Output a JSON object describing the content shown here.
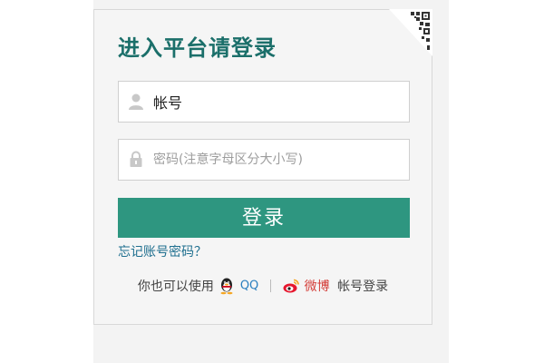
{
  "login": {
    "title": "进入平台请登录",
    "username": {
      "value": "帐号",
      "icon": "user-icon"
    },
    "password": {
      "placeholder": "密码(注意字母区分大小写)",
      "icon": "lock-icon"
    },
    "submit_label": "登录",
    "forgot_label": "忘记账号密码？",
    "qr_icon": "qr-code-icon"
  },
  "social": {
    "prefix": "你也可以使用",
    "qq_label": "QQ",
    "qq_icon": "qq-penguin-icon",
    "weibo_label": "微博",
    "weibo_icon": "weibo-icon",
    "suffix": "帐号登录"
  },
  "colors": {
    "accent": "#2e9680",
    "title": "#1b6f6a",
    "link": "#1f6f8f",
    "panel_bg": "#f5f5f5"
  }
}
